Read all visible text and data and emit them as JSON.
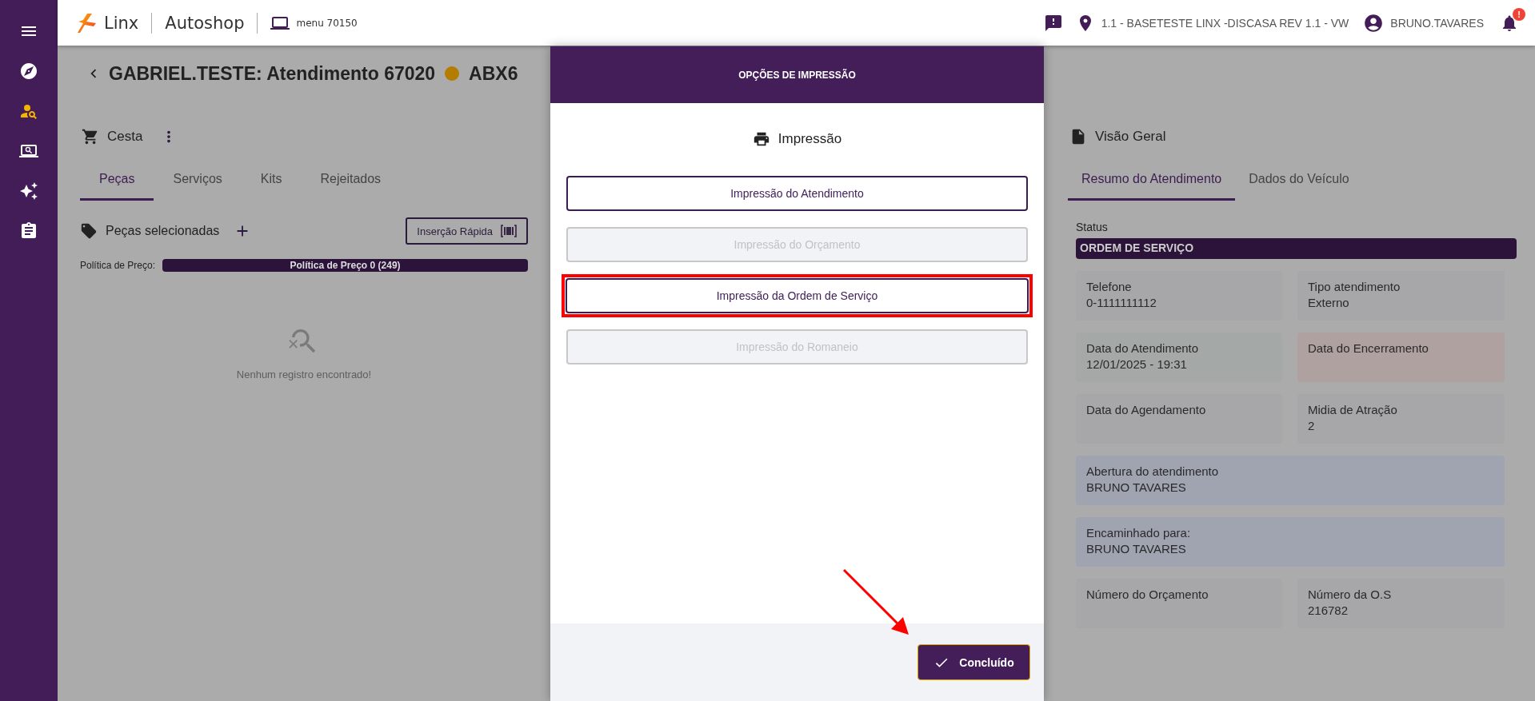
{
  "sidebar": {
    "items": [
      {
        "selected": false
      },
      {
        "selected": true
      },
      {
        "selected": false
      },
      {
        "selected": false
      },
      {
        "selected": false
      }
    ]
  },
  "topbar": {
    "brand": "Linx",
    "product": "Autoshop",
    "menu": "menu 70150",
    "location": "1.1 - BASETESTE LINX -DISCASA REV 1.1 - VW",
    "user": "BRUNO.TAVARES",
    "notification_badge": "!"
  },
  "page": {
    "title": "GABRIEL.TESTE: Atendimento 67020",
    "plate": "ABX6"
  },
  "basket": {
    "title": "Cesta",
    "tabs": [
      {
        "label": "Peças",
        "selected": true
      },
      {
        "label": "Serviços",
        "selected": false
      },
      {
        "label": "Kits",
        "selected": false
      },
      {
        "label": "Rejeitados",
        "selected": false
      }
    ],
    "selected_parts": "Peças selecionadas",
    "quick_insert": "Inserção Rápida",
    "price_policy_label": "Política de Preço:",
    "price_policy": "Política de Preço 0 (249)",
    "empty": "Nenhum registro encontrado!"
  },
  "overview": {
    "title": "Visão Geral",
    "tabs": [
      {
        "label": "Resumo do Atendimento",
        "selected": true
      },
      {
        "label": "Dados do Veículo",
        "selected": false
      }
    ],
    "status_label": "Status",
    "status": "ORDEM DE SERVIÇO",
    "cards": [
      {
        "kind": "half",
        "color": "#a7a7a9",
        "label": "Telefone",
        "value": "0-1111111112"
      },
      {
        "kind": "half",
        "color": "#a7a7a9",
        "label": "Tipo atendimento",
        "value": "Externo"
      },
      {
        "kind": "half",
        "color": "#a4a9a8",
        "label": "Data do Atendimento",
        "value": "12/01/2025 - 19:31"
      },
      {
        "kind": "half",
        "color": "#aea19f",
        "label": "Data do Encerramento"
      },
      {
        "kind": "half",
        "color": "#a7a7a9",
        "label": "Data do Agendamento"
      },
      {
        "kind": "half",
        "color": "#a7a7a9",
        "label": "Midia de Atração",
        "value": "2"
      },
      {
        "kind": "wide",
        "color": "#a0a4b1",
        "label": "Abertura do atendimento",
        "value": "BRUNO TAVARES"
      },
      {
        "kind": "wide",
        "color": "#a0a4b1",
        "label": "Encaminhado para:",
        "value": "BRUNO TAVARES"
      },
      {
        "kind": "half",
        "color": "#a7a7a9",
        "label": "Número do Orçamento"
      },
      {
        "kind": "half",
        "color": "#a7a7a9",
        "label": "Número da O.S",
        "value": "216782"
      }
    ]
  },
  "dialog": {
    "title": "OPÇÕES DE IMPRESSÃO",
    "heading": "Impressão",
    "options": [
      {
        "label": "Impressão do Atendimento",
        "disabled": false,
        "highlighted": false
      },
      {
        "label": "Impressão do Orçamento",
        "disabled": true,
        "highlighted": false
      },
      {
        "label": "Impressão da Ordem de Serviço",
        "disabled": false,
        "highlighted": true
      },
      {
        "label": "Impressão do Romaneio",
        "disabled": true,
        "highlighted": false
      }
    ],
    "confirm": "Concluído"
  }
}
